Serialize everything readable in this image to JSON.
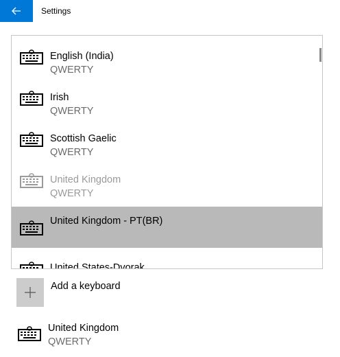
{
  "window": {
    "title": "Settings"
  },
  "keyboard_list": [
    {
      "name": "English (India)",
      "layout": "QWERTY",
      "state": "normal"
    },
    {
      "name": "Irish",
      "layout": "QWERTY",
      "state": "normal"
    },
    {
      "name": "Scottish Gaelic",
      "layout": "QWERTY",
      "state": "normal"
    },
    {
      "name": "United Kingdom",
      "layout": "QWERTY",
      "state": "disabled"
    },
    {
      "name": "United Kingdom - PT(BR)",
      "layout": "",
      "state": "selected"
    },
    {
      "name": "United States-Dvorak",
      "layout": "",
      "state": "normal"
    }
  ],
  "add_keyboard": {
    "label": "Add a keyboard"
  },
  "installed_keyboard": {
    "name": "United Kingdom",
    "layout": "QWERTY"
  },
  "colors": {
    "accent": "#0078d7",
    "selected_bg": "#b9b9b9",
    "add_tile": "#cccccc",
    "secondary_text": "#6b6b6b",
    "disabled_text": "#9a9a9a"
  }
}
